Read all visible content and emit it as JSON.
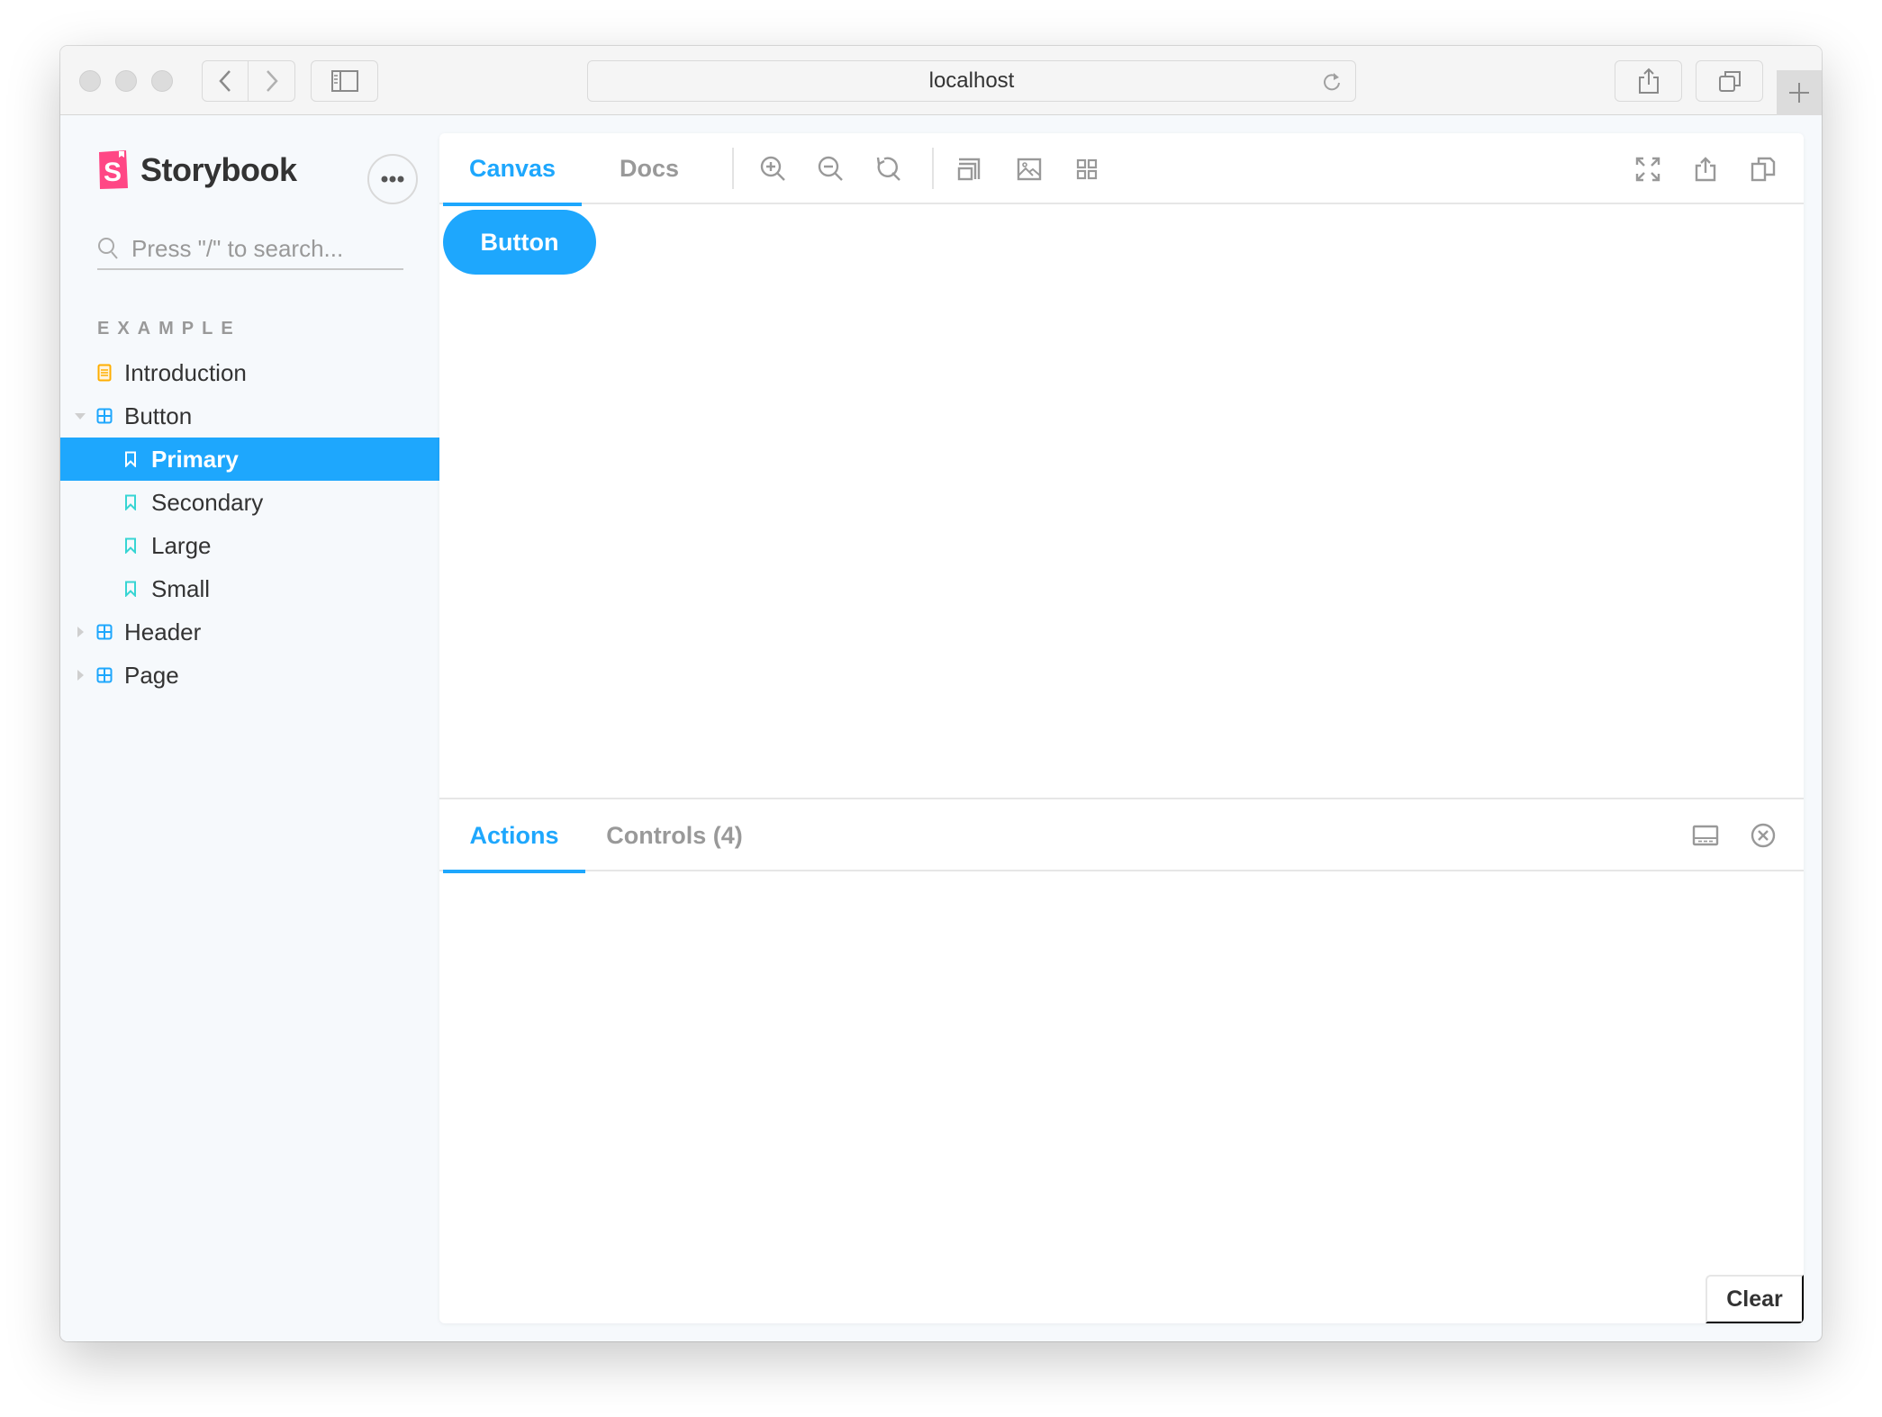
{
  "browser": {
    "url": "localhost",
    "traffic_lights": [
      "close",
      "minimize",
      "zoom"
    ],
    "buttons": {
      "back": "chevron-left-icon",
      "forward": "chevron-right-icon",
      "sidebar_toggle": "sidebar-icon",
      "reload": "reload-icon",
      "share": "share-icon",
      "tabs": "tabs-icon",
      "new_tab": "plus-icon"
    }
  },
  "sidebar": {
    "brand": "Storybook",
    "brand_color": "#ff4785",
    "menu_label": "•••",
    "search_placeholder": "Press \"/\" to search...",
    "section_title": "EXAMPLE",
    "items": [
      {
        "label": "Introduction",
        "type": "document",
        "depth": 0
      },
      {
        "label": "Button",
        "type": "component",
        "depth": 0,
        "expanded": true
      },
      {
        "label": "Primary",
        "type": "story",
        "depth": 1,
        "selected": true
      },
      {
        "label": "Secondary",
        "type": "story",
        "depth": 1
      },
      {
        "label": "Large",
        "type": "story",
        "depth": 1
      },
      {
        "label": "Small",
        "type": "story",
        "depth": 1
      },
      {
        "label": "Header",
        "type": "component",
        "depth": 0,
        "expanded": false
      },
      {
        "label": "Page",
        "type": "component",
        "depth": 0,
        "expanded": false
      }
    ]
  },
  "toolbar": {
    "tabs": [
      {
        "label": "Canvas",
        "active": true
      },
      {
        "label": "Docs",
        "active": false
      }
    ],
    "tools": [
      "zoom-in",
      "zoom-out",
      "zoom-reset",
      "outline",
      "background",
      "grid"
    ],
    "right_tools": [
      "fullscreen",
      "share",
      "copy"
    ]
  },
  "canvas": {
    "preview_button_label": "Button"
  },
  "addons": {
    "tabs": [
      {
        "label": "Actions",
        "active": true
      },
      {
        "label": "Controls (4)",
        "active": false
      }
    ],
    "clear_label": "Clear"
  },
  "colors": {
    "accent": "#1ea7fd",
    "text": "#333333",
    "muted": "#999999"
  }
}
